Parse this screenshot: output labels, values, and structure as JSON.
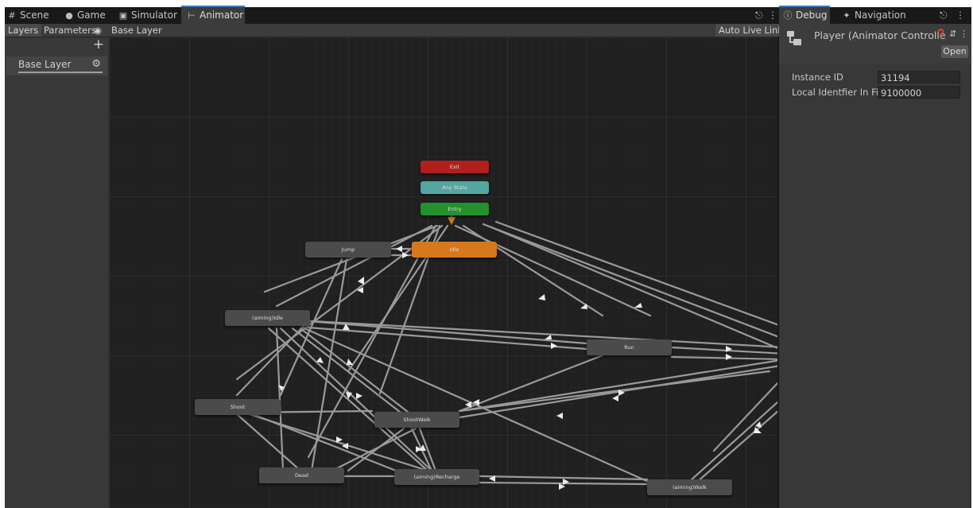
{
  "tabs_left": [
    {
      "label": "Scene",
      "icon": "grid-icon"
    },
    {
      "label": "Game",
      "icon": "gamepad-icon"
    },
    {
      "label": "Simulator",
      "icon": "device-icon"
    },
    {
      "label": "Animator",
      "icon": "animator-icon",
      "active": true
    }
  ],
  "tabs_right": [
    {
      "label": "Debug",
      "icon": "info-icon",
      "active": true
    },
    {
      "label": "Navigation",
      "icon": "navigation-icon"
    }
  ],
  "animator": {
    "toolbar": {
      "layers_label": "Layers",
      "parameters_label": "Parameters",
      "breadcrumb": "Base Layer",
      "auto_live_link_label": "Auto Live Link"
    },
    "layers": [
      {
        "name": "Base Layer"
      }
    ],
    "states": {
      "exit": "Exit",
      "any_state": "Any State",
      "entry": "Entry",
      "idle": "Idle",
      "jump": "Jump",
      "aiming_idle": "(aiming)Idle",
      "run": "Run",
      "shoot": "Shoot",
      "shoot_walk": "ShootWalk",
      "dead": "Dead",
      "aiming_recharge": "(aiming)Recharge",
      "aiming_walk": "(aiming)Walk"
    }
  },
  "inspector": {
    "title": "Player (Animator Controlle",
    "open_label": "Open",
    "fields": [
      {
        "label": "Instance ID",
        "value": "31194"
      },
      {
        "label": "Local Identfier In File",
        "value": "9100000"
      }
    ]
  },
  "colors": {
    "exit": "#b01e1e",
    "any_state": "#55a5a0",
    "entry": "#23912e",
    "default_state": "#d6781e",
    "state": "#4b4b4b",
    "active_tab_accent": "#3a79bb"
  }
}
